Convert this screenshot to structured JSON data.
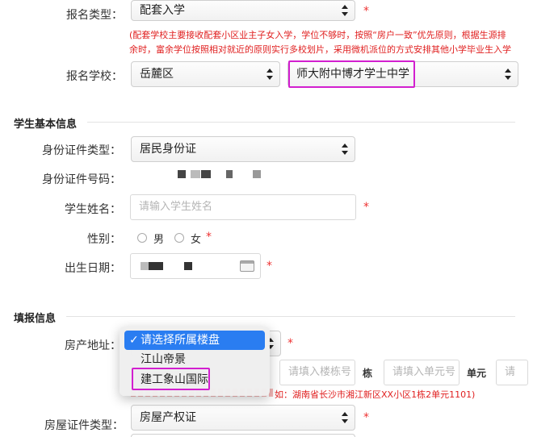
{
  "top_row": {
    "label": "报名类型：",
    "value": "配套入学"
  },
  "notice": {
    "line1": "(配套学校主要接收配套小区业主子女入学，学位不够时，按照“房户一致”优先原则，根据生源排",
    "line2": "余时，富余学位按照相对就近的原则实行多校划片，采用微机派位的方式安排其他小学毕业生入学"
  },
  "school_row": {
    "label": "报名学校：",
    "district": "岳麓区",
    "school": "师大附中博才学士中学"
  },
  "student_section": {
    "title": "学生基本信息",
    "id_type_label": "身份证件类型：",
    "id_type_value": "居民身份证",
    "id_number_label": "身份证件号码：",
    "name_label": "学生姓名：",
    "name_placeholder": "请输入学生姓名",
    "gender_label": "性别：",
    "gender_options": [
      "男",
      "女"
    ],
    "birth_label": "出生日期："
  },
  "fill_section": {
    "title": "填报信息",
    "address_label": "房产地址：",
    "building_placeholder": "请填入楼栋号",
    "building_unit": "栋",
    "unit_placeholder": "请填入单元号",
    "unit_unit": "单元",
    "room_placeholder": "请",
    "example_text": "如：湖南省长沙市湘江新区XX小区1栋2单元1101)",
    "cert_type_label": "房屋证件类型：",
    "cert_type_value": "房屋产权证"
  },
  "dropdown": {
    "options": [
      "请选择所属楼盘",
      "江山帝景",
      "建工象山国际"
    ],
    "selected_index": 0
  },
  "required_mark": "*",
  "colors": {
    "accent_blue": "#2a7df1",
    "required_red": "#e33333",
    "highlight_magenta": "#d21fcf"
  }
}
